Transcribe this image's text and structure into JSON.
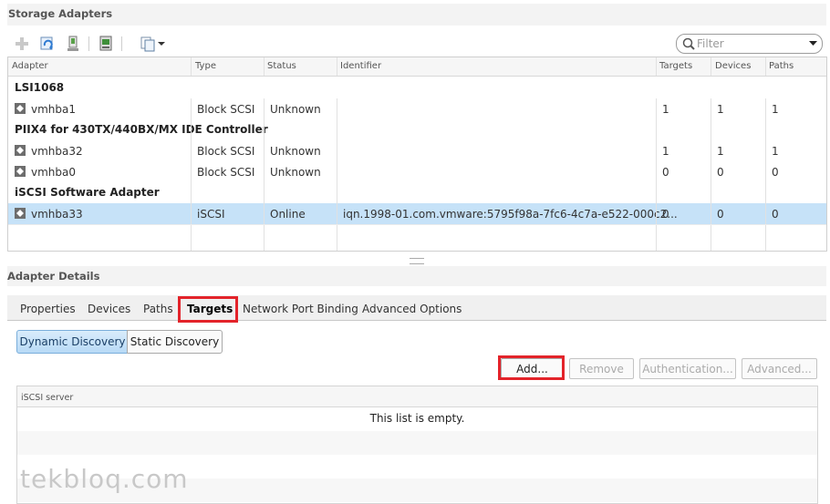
{
  "storage_adapters": {
    "title": "Storage Adapters",
    "toolbar": {
      "icons": [
        "add-icon",
        "refresh-icon",
        "rescan-icon",
        "storage-icon",
        "actions-icon"
      ]
    },
    "filter_placeholder": "Filter",
    "columns": [
      "Adapter",
      "Type",
      "Status",
      "Identifier",
      "Targets",
      "Devices",
      "Paths"
    ],
    "groups": [
      {
        "name": "LSI1068",
        "rows": [
          {
            "adapter": "vmhba1",
            "type": "Block SCSI",
            "status": "Unknown",
            "identifier": "",
            "targets": "1",
            "devices": "1",
            "paths": "1"
          }
        ]
      },
      {
        "name": "PIIX4 for 430TX/440BX/MX IDE Controller",
        "rows": [
          {
            "adapter": "vmhba32",
            "type": "Block SCSI",
            "status": "Unknown",
            "identifier": "",
            "targets": "1",
            "devices": "1",
            "paths": "1"
          },
          {
            "adapter": "vmhba0",
            "type": "Block SCSI",
            "status": "Unknown",
            "identifier": "",
            "targets": "0",
            "devices": "0",
            "paths": "0"
          }
        ]
      },
      {
        "name": "iSCSI Software Adapter",
        "rows": [
          {
            "adapter": "vmhba33",
            "type": "iSCSI",
            "status": "Online",
            "identifier": "iqn.1998-01.com.vmware:5795f98a-7fc6-4c7a-e522-000c2...",
            "targets": "0",
            "devices": "0",
            "paths": "0"
          }
        ]
      }
    ]
  },
  "adapter_details": {
    "title": "Adapter Details",
    "tabs": [
      "Properties",
      "Devices",
      "Paths",
      "Targets",
      "Network Port Binding",
      "Advanced Options"
    ],
    "active_tab": "Targets",
    "discovery": {
      "dynamic": "Dynamic Discovery",
      "static": "Static Discovery"
    },
    "buttons": {
      "add": "Add...",
      "remove": "Remove",
      "authentication": "Authentication...",
      "advanced": "Advanced..."
    },
    "list_header": "iSCSI server",
    "empty_message": "This list is empty."
  },
  "watermark": "tekbloq.com",
  "colors": {
    "selected_row": "#c6e2f8",
    "highlight": "#e3232a"
  }
}
